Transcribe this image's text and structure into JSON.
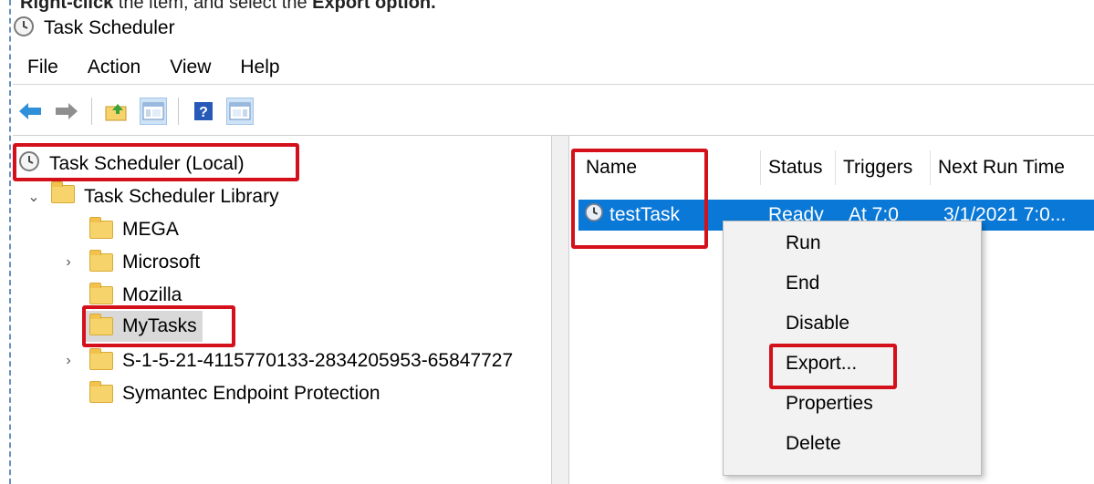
{
  "caption": {
    "bold1": "Right-click",
    "text": " the item, and select the ",
    "bold2": "Export option."
  },
  "window": {
    "title": "Task Scheduler",
    "icon": "clock-icon"
  },
  "menu": [
    "File",
    "Action",
    "View",
    "Help"
  ],
  "toolbar": {
    "icons": [
      "back-arrow-icon",
      "forward-arrow-icon",
      "up-folder-icon",
      "show-hide-console-tree-icon",
      "help-icon",
      "show-hide-action-pane-icon"
    ]
  },
  "tree": {
    "root": "Task Scheduler (Local)",
    "library": "Task Scheduler Library",
    "folders": [
      "MEGA",
      "Microsoft",
      "Mozilla",
      "MyTasks",
      "S-1-5-21-4115770133-2834205953-65847727",
      "Symantec Endpoint Protection"
    ]
  },
  "list": {
    "columns": [
      "Name",
      "Status",
      "Triggers",
      "Next Run Time"
    ],
    "rows": [
      {
        "name": "testTask",
        "status": "Ready",
        "triggers": "At 7:0",
        "next_run": "3/1/2021 7:0..."
      }
    ]
  },
  "context_menu": [
    "Run",
    "End",
    "Disable",
    "Export...",
    "Properties",
    "Delete"
  ],
  "colors": {
    "highlight": "#0a78d7",
    "annotation": "#d4101a",
    "folder": "#f6d36b"
  }
}
